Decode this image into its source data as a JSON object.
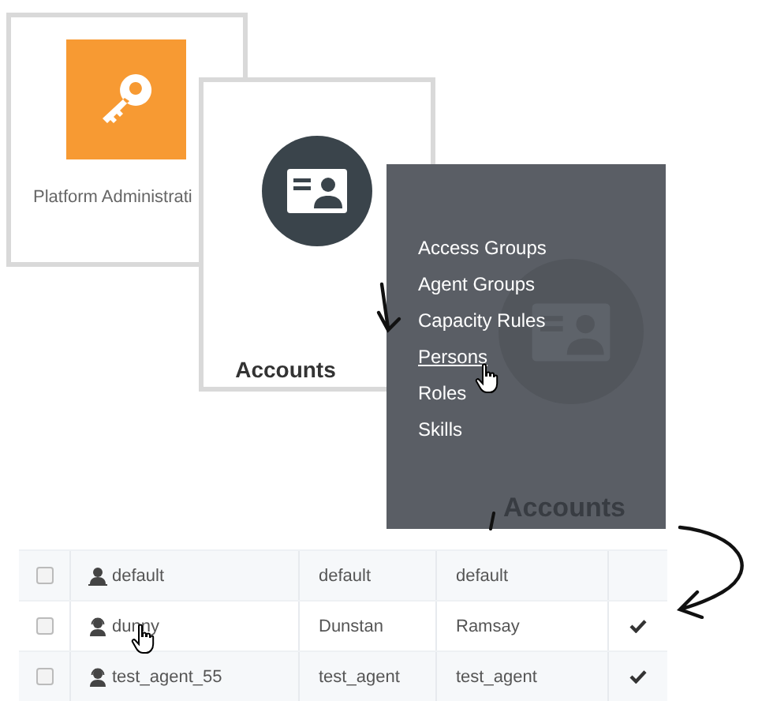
{
  "tiles": [
    {
      "kind": "key",
      "label": "Platform Administrati"
    },
    {
      "kind": "contact",
      "label": "Accounts"
    }
  ],
  "menu": {
    "items": [
      {
        "label": "Access Groups",
        "hovered": false
      },
      {
        "label": "Agent Groups",
        "hovered": false
      },
      {
        "label": "Capacity Rules",
        "hovered": false
      },
      {
        "label": "Persons",
        "hovered": true
      },
      {
        "label": "Roles",
        "hovered": false
      },
      {
        "label": "Skills",
        "hovered": false
      }
    ],
    "ghost_label": "Accounts"
  },
  "table": {
    "rows": [
      {
        "checked": false,
        "kind": "user",
        "name": "default",
        "column_3": "default",
        "column_4": "default",
        "flag": false,
        "hovered": false
      },
      {
        "checked": false,
        "kind": "agent",
        "name": "dunny",
        "column_3": "Dunstan",
        "column_4": "Ramsay",
        "flag": true,
        "hovered": true
      },
      {
        "checked": false,
        "kind": "agent",
        "name": "test_agent_55",
        "column_3": "test_agent",
        "column_4": "test_agent",
        "flag": true,
        "hovered": false
      }
    ]
  }
}
